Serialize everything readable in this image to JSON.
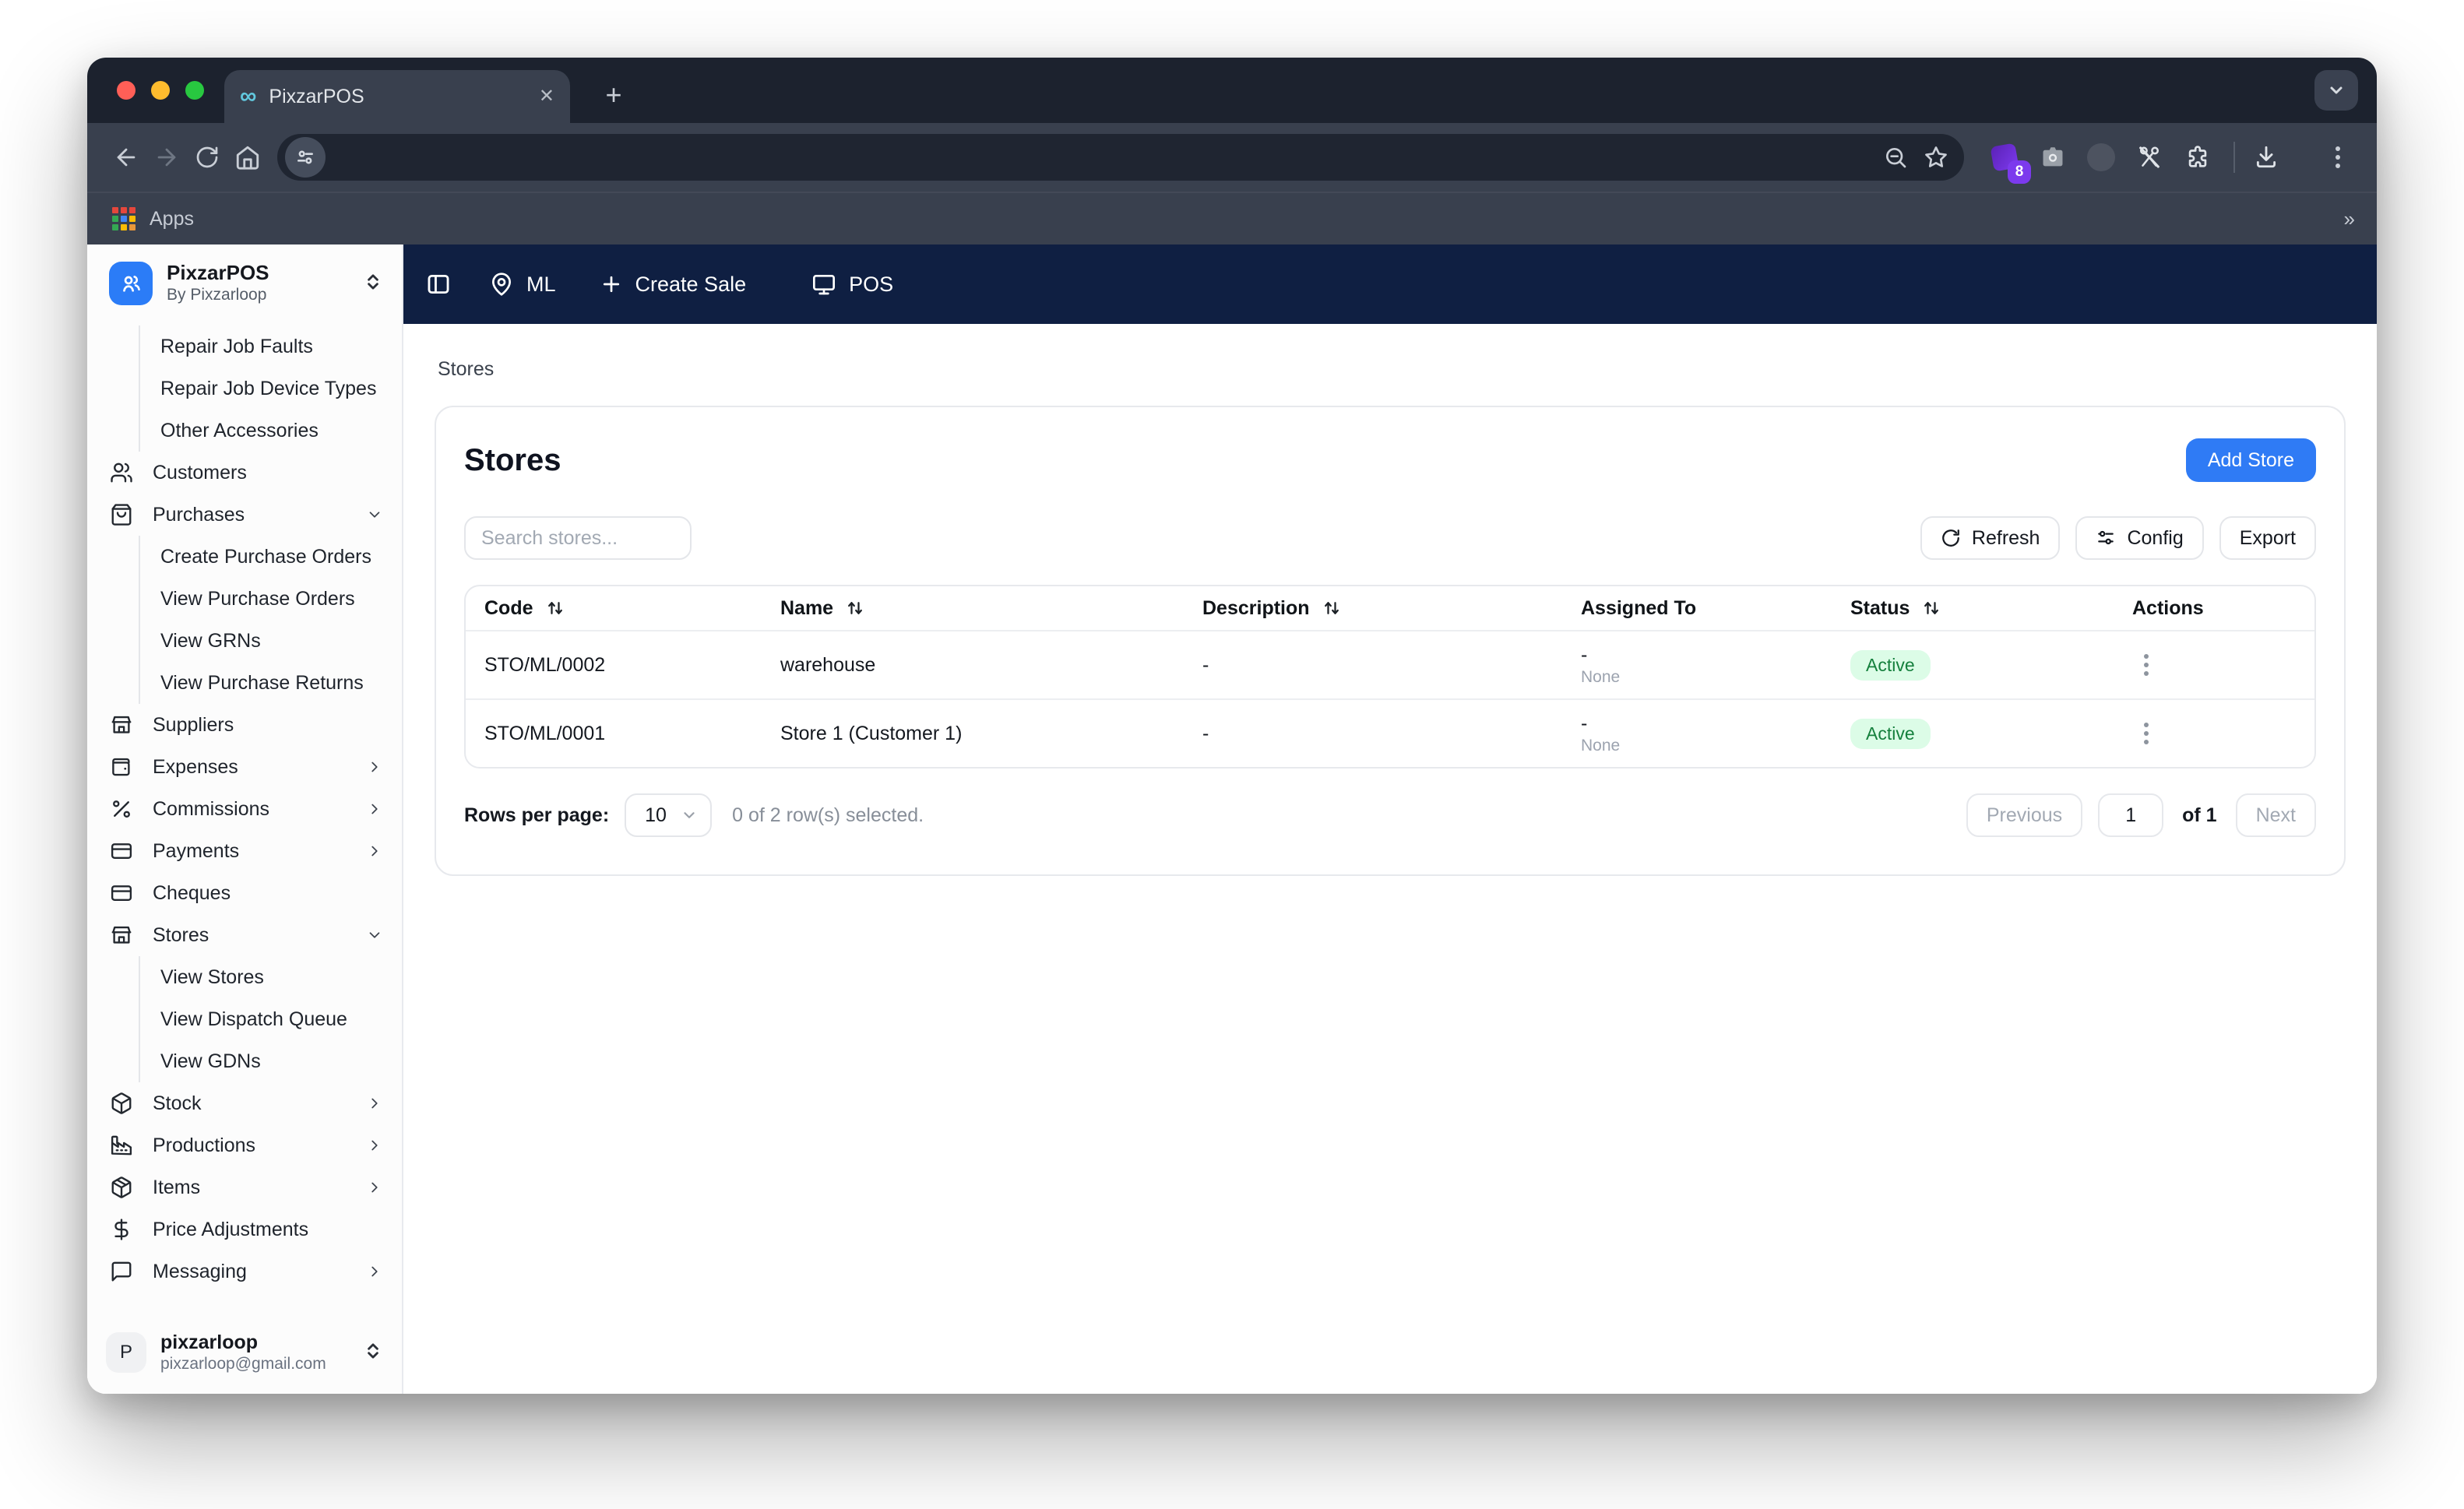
{
  "browser": {
    "tab": {
      "title": "PixzarPOS",
      "favicon_glyph": "∞"
    },
    "toolbar": {
      "extension_badge": "8"
    },
    "bookmarks_bar": {
      "apps_label": "Apps"
    }
  },
  "app_topbar": {
    "location": "ML",
    "create_sale": "Create Sale",
    "pos": "POS"
  },
  "sidebar": {
    "app_name": "PixzarPOS",
    "app_publisher": "By Pixzarloop",
    "items": [
      {
        "label": "Repair Job Faults",
        "sub": true
      },
      {
        "label": "Repair Job Device Types",
        "sub": true
      },
      {
        "label": "Other Accessories",
        "sub": true
      },
      {
        "label": "Customers",
        "icon": "users"
      },
      {
        "label": "Purchases",
        "icon": "bag",
        "chevron": "down"
      },
      {
        "label": "Create Purchase Orders",
        "sub": true
      },
      {
        "label": "View Purchase Orders",
        "sub": true
      },
      {
        "label": "View GRNs",
        "sub": true
      },
      {
        "label": "View Purchase Returns",
        "sub": true
      },
      {
        "label": "Suppliers",
        "icon": "store"
      },
      {
        "label": "Expenses",
        "icon": "wallet",
        "chevron": "right"
      },
      {
        "label": "Commissions",
        "icon": "percent",
        "chevron": "right"
      },
      {
        "label": "Payments",
        "icon": "card",
        "chevron": "right"
      },
      {
        "label": "Cheques",
        "icon": "card"
      },
      {
        "label": "Stores",
        "icon": "store",
        "chevron": "down"
      },
      {
        "label": "View Stores",
        "sub": true
      },
      {
        "label": "View Dispatch Queue",
        "sub": true
      },
      {
        "label": "View GDNs",
        "sub": true
      },
      {
        "label": "Stock",
        "icon": "box",
        "chevron": "right"
      },
      {
        "label": "Productions",
        "icon": "factory",
        "chevron": "right"
      },
      {
        "label": "Items",
        "icon": "package",
        "chevron": "right"
      },
      {
        "label": "Price Adjustments",
        "icon": "dollar"
      },
      {
        "label": "Messaging",
        "icon": "message",
        "chevron": "right"
      }
    ],
    "user": {
      "initial": "P",
      "name": "pixzarloop",
      "email": "pixzarloop@gmail.com"
    }
  },
  "page": {
    "breadcrumb": "Stores",
    "title": "Stores",
    "add_store_button": "Add Store",
    "search_placeholder": "Search stores...",
    "refresh_button": "Refresh",
    "config_button": "Config",
    "export_button": "Export",
    "table": {
      "columns": [
        {
          "label": "Code",
          "sortable": true
        },
        {
          "label": "Name",
          "sortable": true
        },
        {
          "label": "Description",
          "sortable": true
        },
        {
          "label": "Assigned To",
          "sortable": false
        },
        {
          "label": "Status",
          "sortable": true
        },
        {
          "label": "Actions",
          "sortable": false
        }
      ],
      "rows": [
        {
          "code": "STO/ML/0002",
          "name": "warehouse",
          "description": "-",
          "assigned_to": "-",
          "assigned_to_note": "None",
          "status": "Active"
        },
        {
          "code": "STO/ML/0001",
          "name": "Store 1 (Customer 1)",
          "description": "-",
          "assigned_to": "-",
          "assigned_to_note": "None",
          "status": "Active"
        }
      ]
    },
    "pagination": {
      "rows_per_page_label": "Rows per page:",
      "rows_per_page_value": "10",
      "selection_text": "0 of 2 row(s) selected.",
      "previous_label": "Previous",
      "current_page": "1",
      "of_label": "of 1",
      "next_label": "Next"
    }
  },
  "colors": {
    "primary_blue": "#2f7bf5",
    "topbar_navy": "#0f1f42",
    "status_active_bg": "#dcfce7",
    "status_active_text": "#15803d"
  }
}
